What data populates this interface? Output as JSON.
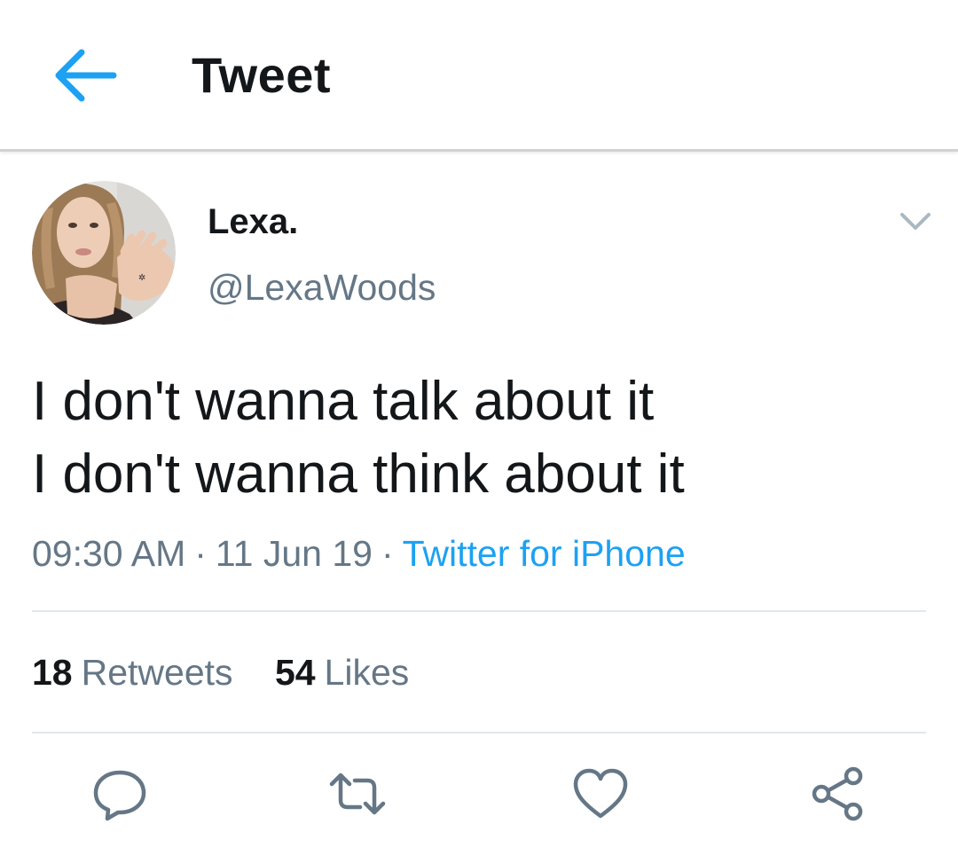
{
  "header": {
    "back_icon": "arrow-left-icon",
    "title": "Tweet",
    "accent_color": "#1da1f2"
  },
  "tweet": {
    "author": {
      "display_name": "Lexa.",
      "handle": "@LexaWoods",
      "avatar": "profile-photo"
    },
    "caret_icon": "chevron-down-icon",
    "lines": [
      "I don't wanna talk about it",
      "I don't wanna think about it"
    ],
    "time": "09:30 AM",
    "date": "11 Jun 19",
    "separator": "·",
    "source": "Twitter for iPhone",
    "stats": {
      "retweets_count": "18",
      "retweets_label": "Retweets",
      "likes_count": "54",
      "likes_label": "Likes"
    },
    "actions": [
      {
        "name": "reply",
        "icon": "speech-bubble-icon"
      },
      {
        "name": "retweet",
        "icon": "retweet-arrows-icon"
      },
      {
        "name": "like",
        "icon": "heart-icon"
      },
      {
        "name": "share",
        "icon": "share-nodes-icon"
      }
    ]
  },
  "colors": {
    "text_primary": "#14171a",
    "text_secondary": "#657786",
    "link": "#1da1f2",
    "divider": "#e1e8ed",
    "icon": "#657786"
  }
}
